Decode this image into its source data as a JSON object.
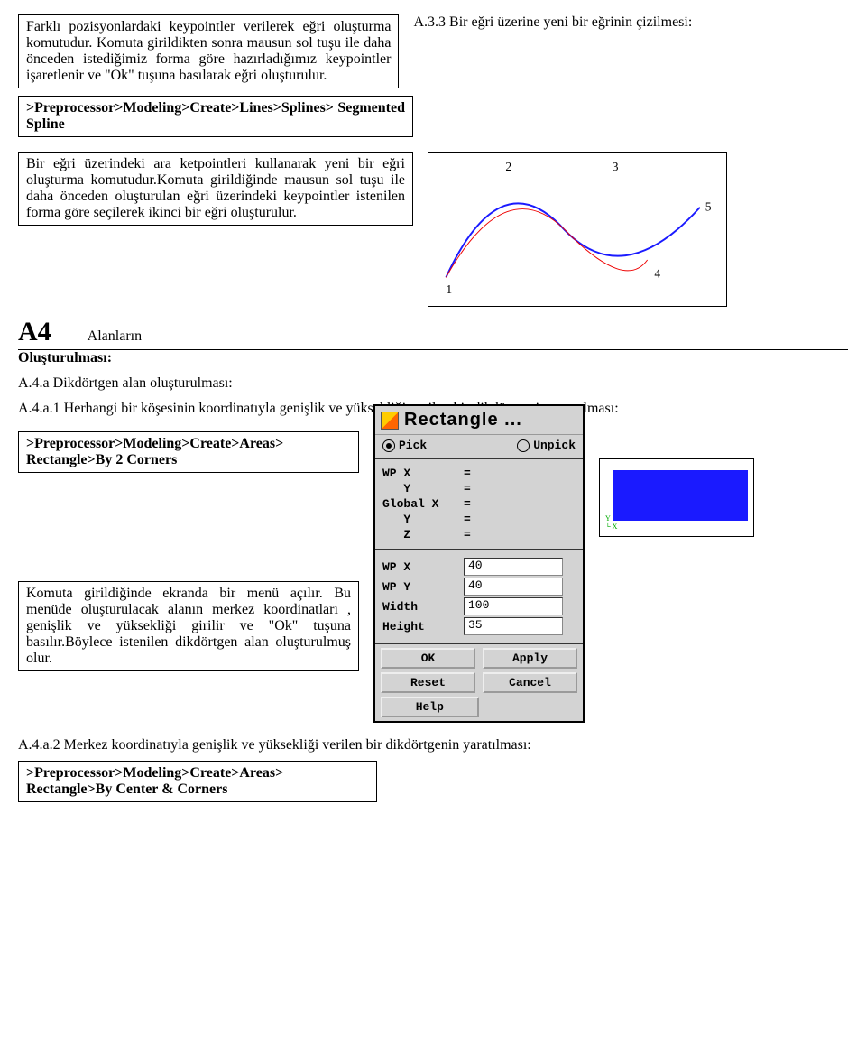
{
  "intro": {
    "p1": "Farklı pozisyonlardaki keypointler verilerek eğri oluşturma komutudur. Komuta girildikten sonra mausun sol tuşu ile daha önceden istediğimiz forma göre hazırladığımız keypointler işaretlenir ve \"Ok\" tuşuna basılarak eğri oluşturulur.",
    "path1": ">Preprocessor>Modeling>Create>Lines>Splines> Segmented Spline",
    "a33": "A.3.3 Bir eğri üzerine yeni bir eğrinin çizilmesi:"
  },
  "curve": {
    "desc": "Bir eğri üzerindeki ara ketpointleri kullanarak yeni bir eğri oluşturma komutudur.Komuta girildiğinde mausun sol tuşu ile daha önceden oluşturulan eğri üzerindeki keypointler istenilen forma göre seçilerek ikinci bir eğri oluşturulur.",
    "labels": [
      "1",
      "2",
      "3",
      "4",
      "5"
    ]
  },
  "a4": {
    "num": "A4",
    "title": "Alanların",
    "subtitle": "Oluşturulması:",
    "a4a": "A.4.a Dikdörtgen alan oluşturulması:",
    "a4a1": "A.4.a.1 Herhangi bir köşesinin koordinatıyla genişlik ve yüksekliği verilen bir dikdörtgenin yaratılması:",
    "path_rect": ">Preprocessor>Modeling>Create>Areas> Rectangle>By 2 Corners",
    "menu_desc": "Komuta girildiğinde ekranda bir menü açılır. Bu menüde oluşturulacak alanın merkez koordinatları , genişlik ve yüksekliği girilir ve \"Ok\" tuşuna basılır.Böylece istenilen dikdörtgen alan oluşturulmuş olur.",
    "a4a2": "A.4.a.2 Merkez koordinatıyla genişlik ve yüksekliği verilen bir dikdörtgenin yaratılması:",
    "path_center": ">Preprocessor>Modeling>Create>Areas> Rectangle>By Center & Corners"
  },
  "dialog": {
    "title": "Rectangle ...",
    "pick": "Pick",
    "unpick": "Unpick",
    "rows1": [
      {
        "lbl": "WP X",
        "eq": "="
      },
      {
        "lbl": "   Y",
        "eq": "="
      },
      {
        "lbl": "Global X",
        "eq": "="
      },
      {
        "lbl": "   Y",
        "eq": "="
      },
      {
        "lbl": "   Z",
        "eq": "="
      }
    ],
    "rows2": [
      {
        "lbl": "WP X",
        "val": "40"
      },
      {
        "lbl": "WP Y",
        "val": "40"
      },
      {
        "lbl": "Width",
        "val": "100"
      },
      {
        "lbl": "Height",
        "val": "35"
      }
    ],
    "buttons": {
      "ok": "OK",
      "apply": "Apply",
      "reset": "Reset",
      "cancel": "Cancel",
      "help": "Help"
    }
  }
}
